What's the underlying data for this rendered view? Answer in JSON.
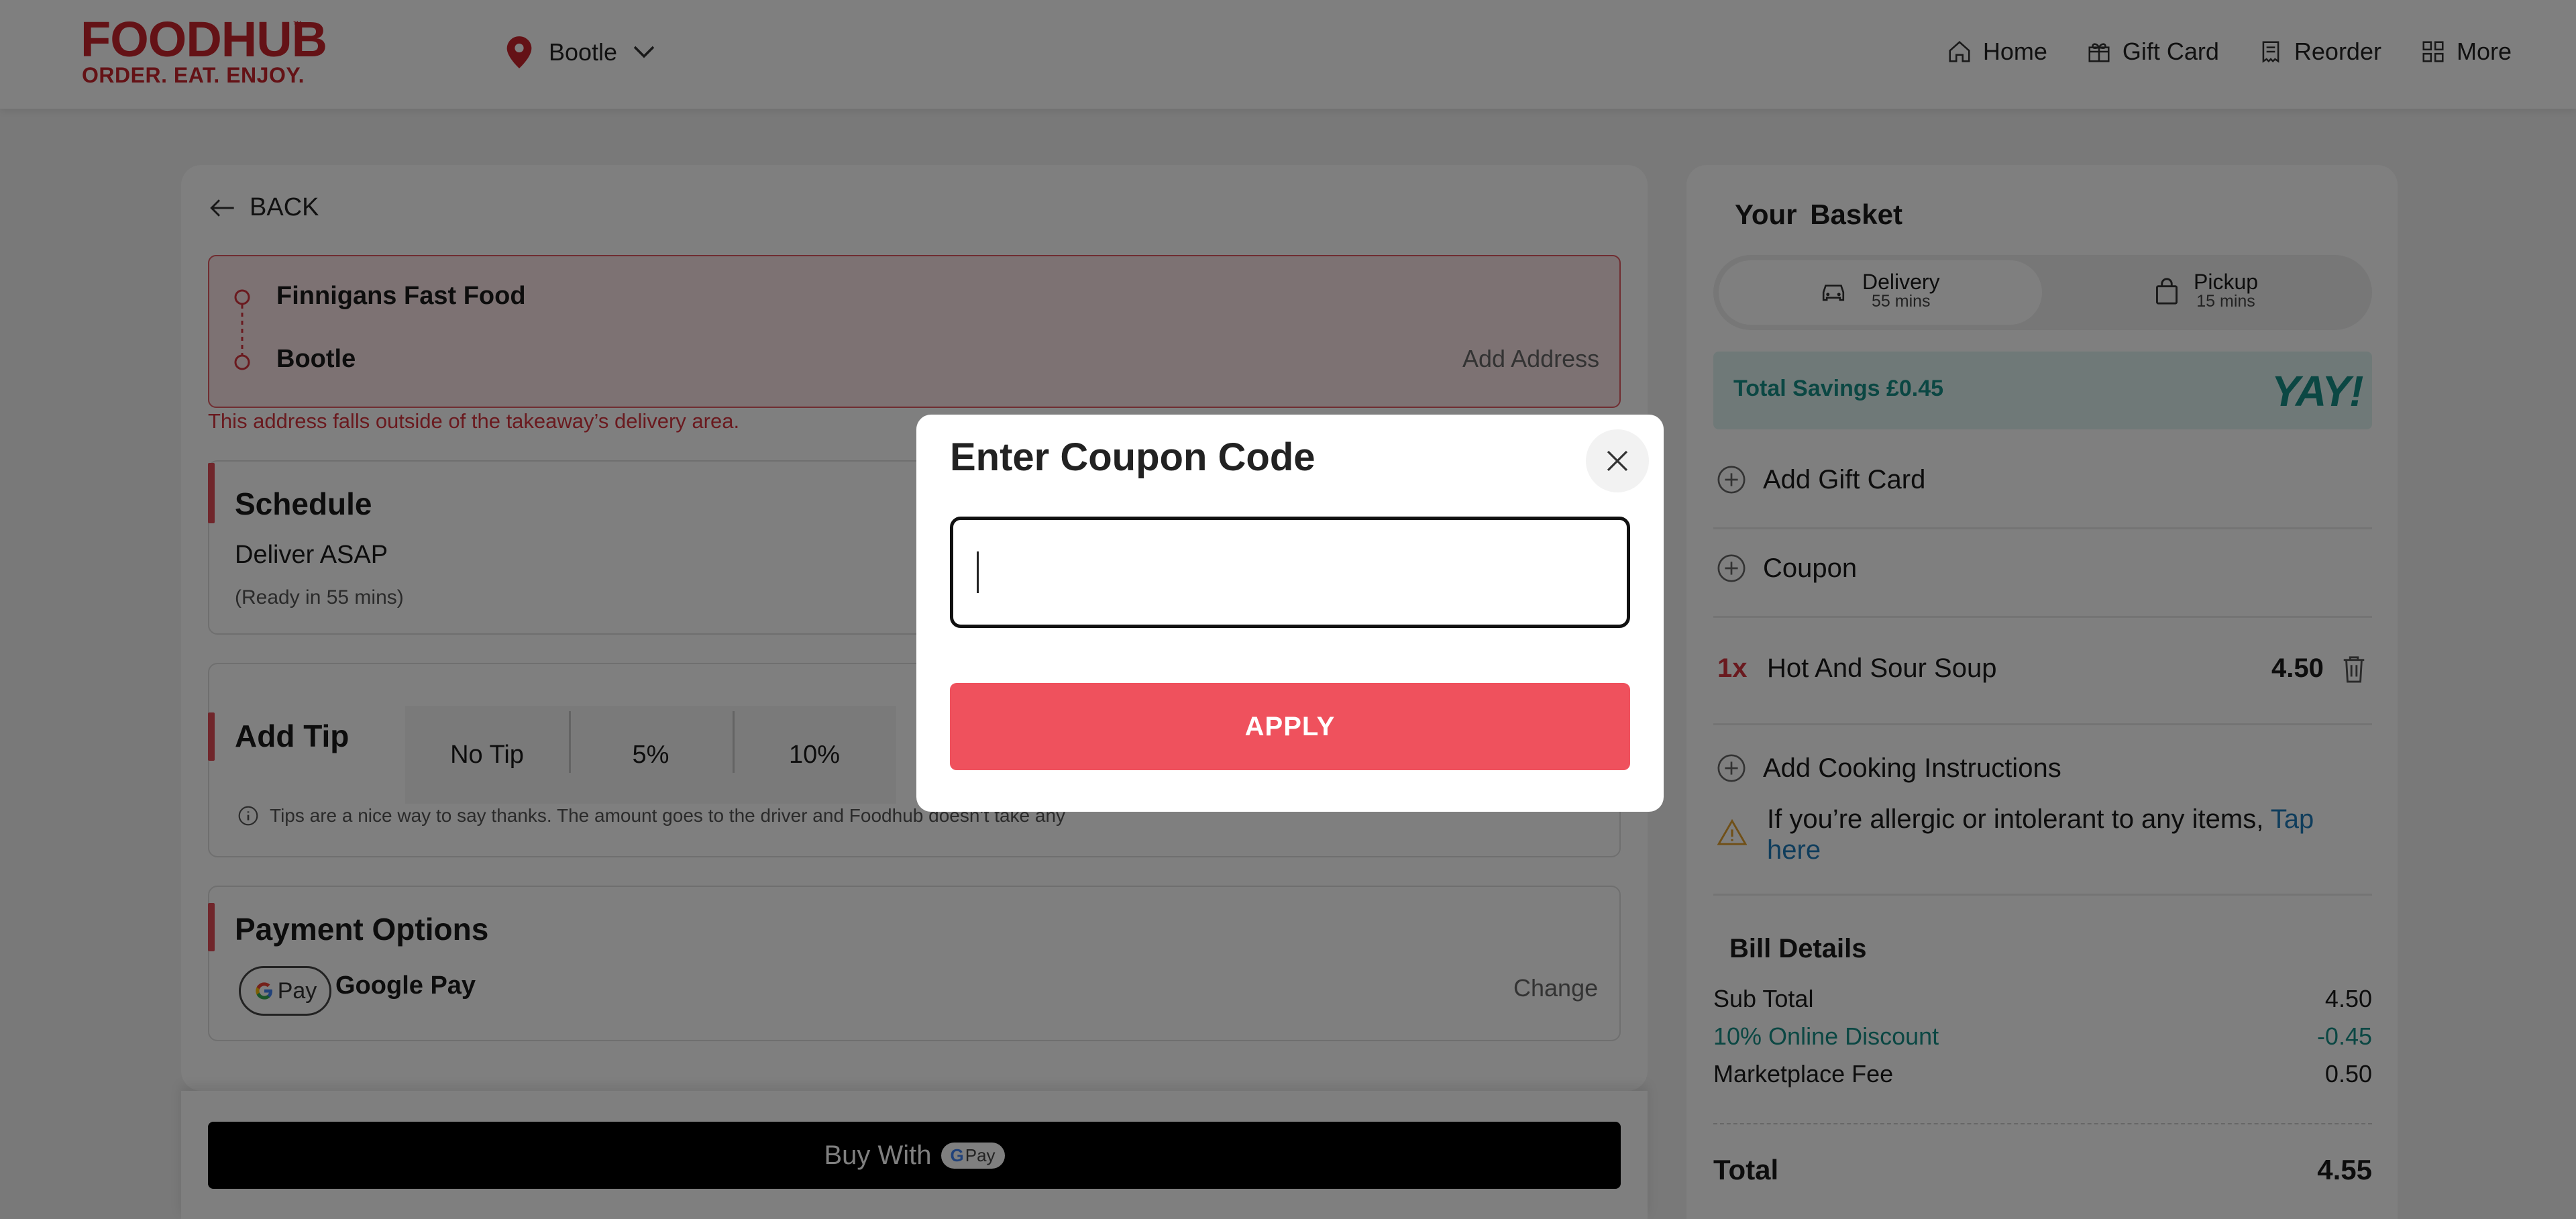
{
  "header": {
    "logo_text": "FOODHUB",
    "logo_tm": "™",
    "logo_tagline": "ORDER. EAT. ENJOY.",
    "location": "Bootle",
    "nav": [
      {
        "label": "Home",
        "icon": "home-icon"
      },
      {
        "label": "Gift Card",
        "icon": "gift-icon"
      },
      {
        "label": "Reorder",
        "icon": "receipt-icon"
      },
      {
        "label": "More",
        "icon": "grid-icon"
      }
    ]
  },
  "checkout": {
    "back_label": "BACK",
    "address": {
      "restaurant": "Finnigans Fast Food",
      "location": "Bootle",
      "add_address_label": "Add Address",
      "error": "This address falls outside of the takeaway’s delivery area."
    },
    "schedule": {
      "title": "Schedule",
      "value": "Deliver ASAP",
      "sub": "(Ready in 55 mins)"
    },
    "tip": {
      "title": "Add Tip",
      "options": [
        "No Tip",
        "5%",
        "10%"
      ],
      "info": "Tips are a nice way to say thanks. The amount goes to the driver and Foodhub doesn’t take any"
    },
    "payment": {
      "title": "Payment Options",
      "chip_label": "Pay",
      "method": "Google Pay",
      "change_label": "Change"
    },
    "buy_label": "Buy With",
    "buy_badge": "Pay"
  },
  "basket": {
    "title": "Your Basket",
    "delivery": {
      "label": "Delivery",
      "time": "55 mins"
    },
    "pickup": {
      "label": "Pickup",
      "time": "15 mins"
    },
    "savings": "Total Savings £0.45",
    "yay": "YAY!",
    "add_gift_card": "Add Gift Card",
    "coupon": "Coupon",
    "item": {
      "qty": "1x",
      "name": "Hot And Sour Soup",
      "price": "4.50"
    },
    "cooking": "Add Cooking Instructions",
    "allergy_text": "If you’re allergic or intolerant to any items,",
    "allergy_link": "Tap here",
    "bill": {
      "title": "Bill Details",
      "rows": [
        {
          "label": "Sub Total",
          "value": "4.50"
        },
        {
          "label": "10% Online Discount",
          "value": "-0.45"
        },
        {
          "label": "Marketplace Fee",
          "value": "0.50"
        }
      ],
      "total_label": "Total",
      "total_value": "4.55"
    }
  },
  "modal": {
    "title": "Enter Coupon Code",
    "input_value": "",
    "apply_label": "APPLY"
  },
  "colors": {
    "brand": "#c8252d",
    "apply": "#ef515d",
    "teal": "#168f87",
    "link": "#1f7ab8"
  }
}
